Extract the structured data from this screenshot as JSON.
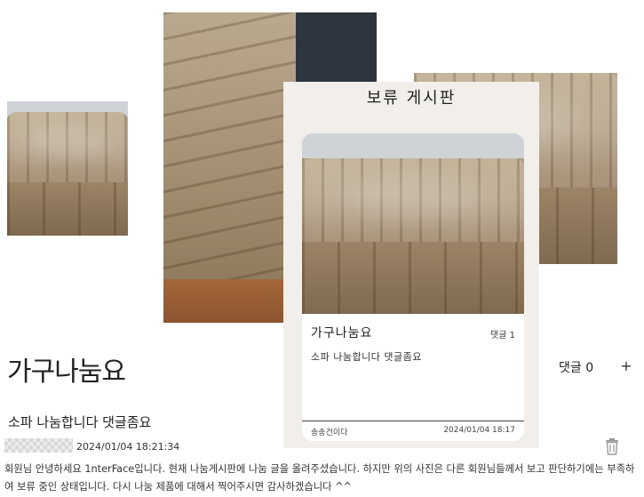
{
  "card": {
    "board_title": "보류 게시판",
    "item_title": "가구나눔요",
    "comment_count": "댓글 1",
    "description": "소파 나눔합니다 댓글좀요",
    "author": "송송건이다",
    "date": "2024/01/04 18:17"
  },
  "post": {
    "title": "가구나눔요",
    "comments_label": "댓글 0",
    "add_label": "+",
    "subtitle": "소파 나눔합니다 댓글좀요"
  },
  "comment": {
    "timestamp": "2024/01/04 18:21:34",
    "text": "회원님 안녕하세요 1nterFace입니다. 현재 나눔게시판에 나눔 글을 올려주셨습니다. 하지만 위의 사진은 다른 회원님들께서 보고 판단하기에는 부족하여 보류 중인 상태입니다. 다시 나눔 제품에 대해서 찍어주시면 감사하겠습니다 ^^"
  },
  "icons": {
    "delete": "trash-icon",
    "add": "plus-icon"
  },
  "colors": {
    "card_background": "#f2efeb",
    "text": "#222222"
  }
}
